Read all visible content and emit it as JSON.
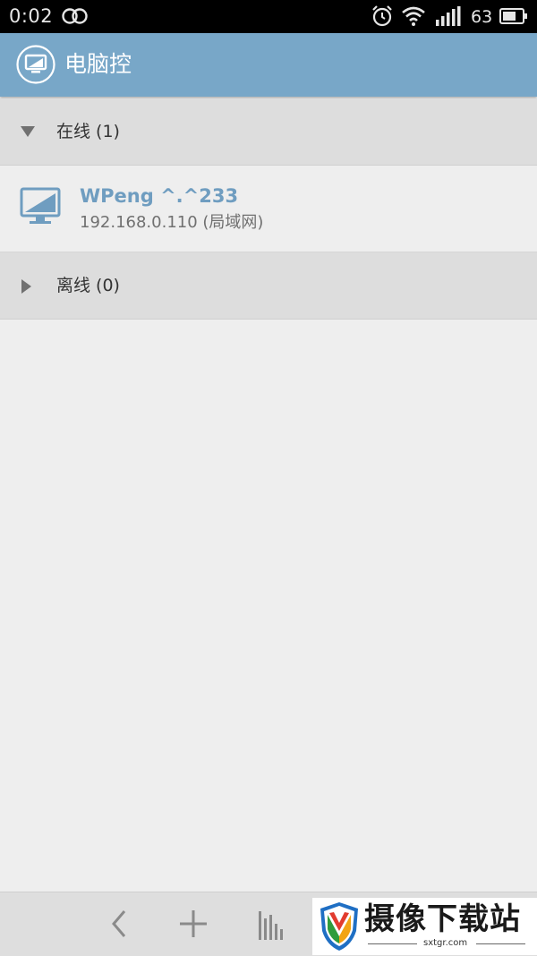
{
  "status_bar": {
    "time": "0:02",
    "battery_percent": "63",
    "icons": [
      "link-icon",
      "alarm-icon",
      "wifi-icon",
      "signal-icon",
      "battery-icon"
    ]
  },
  "app_bar": {
    "title": "电脑控",
    "logo_icon": "monitor-icon",
    "color": "#78a7c8"
  },
  "groups": [
    {
      "label": "在线 (1)",
      "expanded": true,
      "devices": [
        {
          "name": "WPeng ^.^233",
          "address": "192.168.0.110 (局域网)",
          "icon": "monitor-icon"
        }
      ]
    },
    {
      "label": "离线 (0)",
      "expanded": false,
      "devices": []
    }
  ],
  "nav_bar": {
    "buttons": [
      "back-icon",
      "add-icon",
      "stats-icon"
    ]
  },
  "watermark": {
    "text": "摄像下载站",
    "url": "sxtgr.com"
  },
  "colors": {
    "accent": "#78a7c8",
    "device_name": "#6f9dc0",
    "background": "#eeeeee",
    "group_header": "#dddddd"
  }
}
